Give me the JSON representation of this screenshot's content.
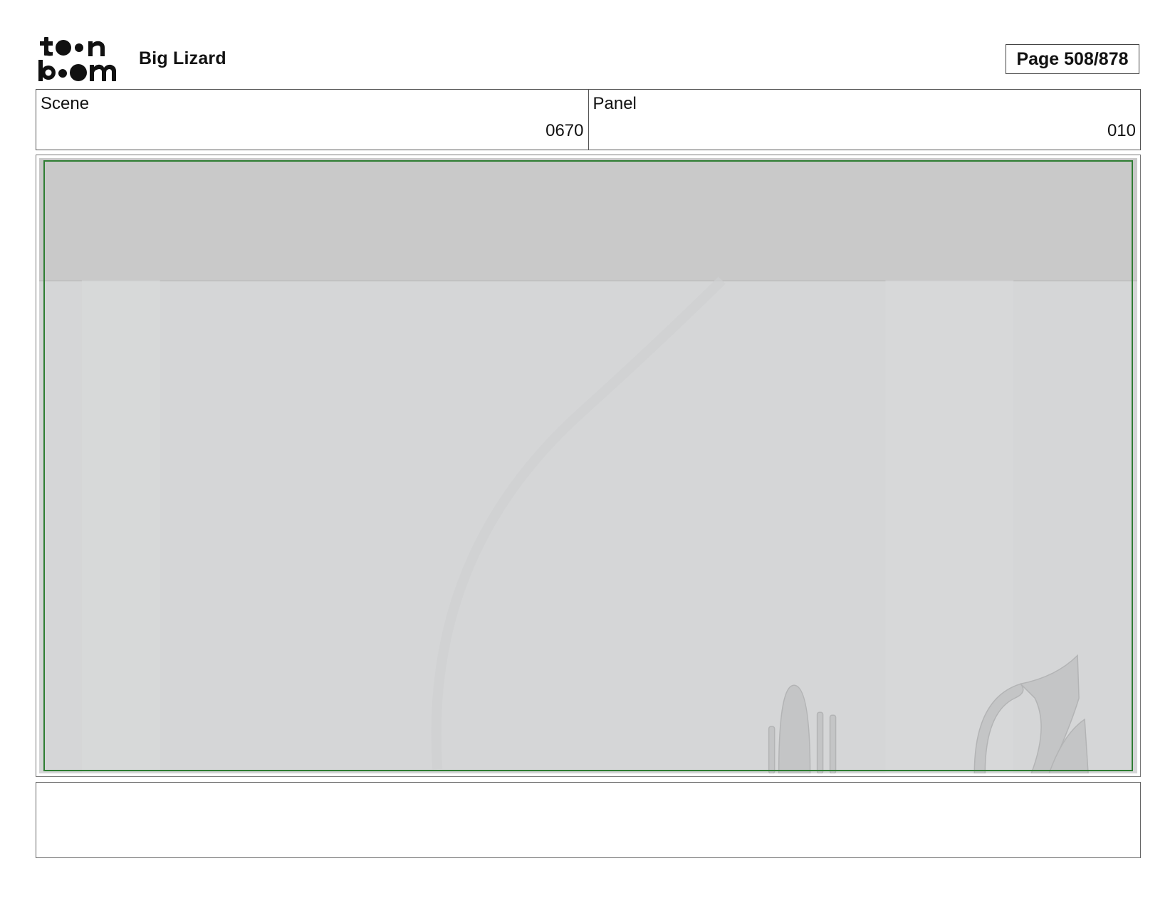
{
  "header": {
    "project_title": "Big Lizard",
    "page_label": "Page 508/878"
  },
  "logo": {
    "text": "toon boom"
  },
  "info": {
    "scene_label": "Scene",
    "scene_value": "0670",
    "panel_label": "Panel",
    "panel_value": "010"
  },
  "frame": {
    "safe_area_color": "#2e7d32",
    "background_color": "#d5d6d7",
    "top_band_color": "#c9c9c9"
  },
  "notes": {
    "text": ""
  }
}
